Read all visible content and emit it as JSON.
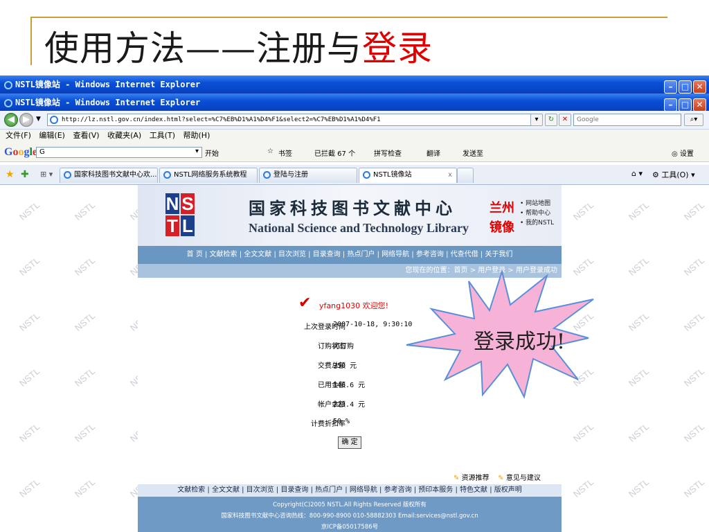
{
  "slide": {
    "title_black": "使用方法——注册与",
    "title_red": "登录"
  },
  "windows": [
    {
      "title": "NSTL镜像站 - Windows Internet Explorer"
    },
    {
      "title": "NSTL镜像站 - Windows Internet Explorer"
    }
  ],
  "address": {
    "url": "http://lz.nstl.gov.cn/index.html?select=%C7%EB%D1%A1%D4%F1&select2=%C7%EB%D1%A1%D4%F1",
    "search_placeholder": "Google"
  },
  "menu": [
    "文件(F)",
    "编辑(E)",
    "查看(V)",
    "收藏夹(A)",
    "工具(T)",
    "帮助(H)"
  ],
  "google_toolbar": {
    "logo": "Google",
    "search_value": "G",
    "start": "开始",
    "bookmarks": "书签",
    "blocked": "已拦截 67 个",
    "spell": "拼写检查",
    "translate": "翻译",
    "send": "发送至",
    "settings": "设置"
  },
  "tabs": [
    {
      "label": "国家科技图书文献中心欢..."
    },
    {
      "label": "NSTL网络服务系统教程"
    },
    {
      "label": "登陆与注册"
    },
    {
      "label": "NSTL镜像站"
    }
  ],
  "tabs_right": {
    "tools": "工具(O)"
  },
  "site": {
    "logo_top": [
      "N",
      "S"
    ],
    "logo_bottom": [
      "T",
      "L"
    ],
    "cn_name": "国家科技图书文献中心",
    "en_name": "National Science and Technology Library",
    "mirror_line1": "兰州",
    "mirror_line2": "镜像",
    "quick_links": [
      "网站地图",
      "帮助中心",
      "我的NSTL"
    ],
    "nav": "首 页 | 文献检索 | 全文文献 | 目次浏览 | 目录查询 | 热点门户 | 网络导航 | 参考咨询 | 代查代借 | 关于我们",
    "breadcrumb": "您现在的位置：首页 > 用户登录 > 用户登录成功",
    "welcome_user": "yfang1030",
    "welcome_text": "欢迎您!",
    "rows": [
      {
        "label": "上次登录时间",
        "value": "2007-10-18, 9:30:10"
      },
      {
        "label": "订购状态",
        "value": "可订购"
      },
      {
        "label": "交费总额",
        "value": "350 元"
      },
      {
        "label": "已用金额",
        "value": "146.6 元"
      },
      {
        "label": "帐户余额",
        "value": "223.4 元"
      },
      {
        "label": "计费折扣率",
        "value": "50 %"
      }
    ],
    "ok_button": "确 定",
    "link_recommend": "资源推荐",
    "link_feedback": "意见与建议",
    "footer_nav": "文献检索 | 全文文献 | 目次浏览 | 目录查询 | 热点门户 | 网络导航 | 参考咨询 | 预印本服务 | 特色文献 | 版权声明",
    "footer_line1": "Copyright(C)2005 NSTL.All Rights Reserved 版权所有",
    "footer_line2": "国家科技图书文献中心咨询热线：800-990-8900 010-58882303 Email:services@nstl.gov.cn",
    "footer_line3": "京ICP备05017586号"
  },
  "watermark": "NSTL",
  "burst_text": "登录成功!",
  "colors": {
    "slide_red": "#e00000",
    "burst_fill": "#f7b3d7",
    "burst_stroke": "#5a8fd8",
    "nav_blue": "#6a96c2"
  }
}
